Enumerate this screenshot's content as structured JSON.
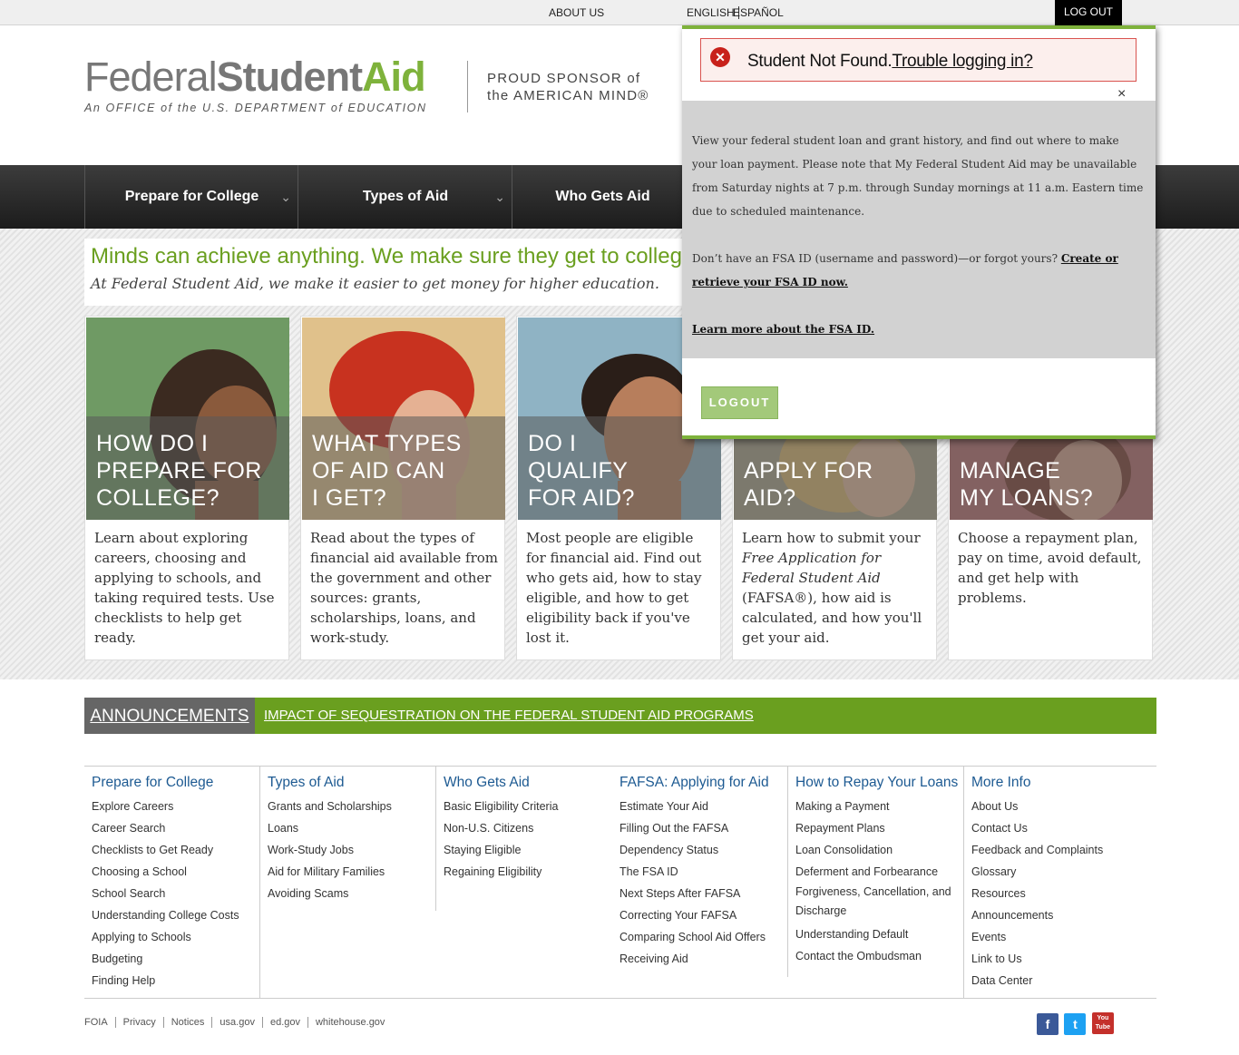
{
  "topbar": {
    "about": "ABOUT US",
    "lang_en": "ENGLISH",
    "lang_es": "ESPAÑOL",
    "logout": "LOG OUT"
  },
  "logo": {
    "federal": "Federal",
    "student": "Student",
    "aid": "Aid",
    "subtitle": "An OFFICE of the U.S. DEPARTMENT of EDUCATION",
    "sponsor_line1": "PROUD SPONSOR of",
    "sponsor_line2": "the AMERICAN MIND®"
  },
  "nav": {
    "items": [
      {
        "label": "Prepare for College",
        "has_dropdown": true
      },
      {
        "label": "Types of Aid",
        "has_dropdown": true
      },
      {
        "label": "Who Gets Aid",
        "has_dropdown": false
      }
    ]
  },
  "tagline": {
    "headline": "Minds can achieve anything. We make sure they get to college.",
    "sub": "At Federal Student Aid, we make it easier to get money for higher education."
  },
  "cards": [
    {
      "caption_l1": "HOW DO I",
      "caption_l2": "PREPARE FOR",
      "caption_l3": "COLLEGE?",
      "desc": "Learn about exploring careers, choosing and applying to schools, and taking required tests.  Use checklists to help get ready.",
      "color": "#6f9a64"
    },
    {
      "caption_l1": "WHAT TYPES",
      "caption_l2": "OF AID CAN",
      "caption_l3": "I GET?",
      "desc": "Read about the types of financial aid available from the government and other sources: grants, scholarships, loans, and work-study.",
      "color": "#d9b783"
    },
    {
      "caption_l1": "DO I",
      "caption_l2": "QUALIFY",
      "caption_l3": "FOR AID?",
      "desc": "Most people are eligible for financial aid. Find out who gets aid, how to stay eligible, and how to get eligibility back if you've lost it.",
      "color": "#8fb3c4"
    },
    {
      "caption_l1": "",
      "caption_l2": "APPLY FOR",
      "caption_l3": "AID?",
      "desc_html": true,
      "desc_a": "Learn how to submit your ",
      "desc_b": "Free Application for Federal Student Aid",
      "desc_c": " (FAFSA®), how aid is calculated, and how you'll get your aid.",
      "color": "#a7a186"
    },
    {
      "caption_l1": "",
      "caption_l2": "MANAGE",
      "caption_l3": "MY LOANS?",
      "desc": "Choose a repayment plan, pay on time, avoid default, and get help with problems.",
      "color": "#b76b6b"
    }
  ],
  "announcements": {
    "label": "ANNOUNCEMENTS",
    "link": "IMPACT OF SEQUESTRATION ON THE FEDERAL STUDENT AID PROGRAMS"
  },
  "footer": {
    "columns": [
      {
        "title": "Prepare for College",
        "items": [
          "Explore Careers",
          "Career Search",
          "Checklists to Get Ready",
          "Choosing a School",
          "School Search",
          "Understanding College Costs",
          "Applying to Schools",
          "Budgeting",
          "Finding Help"
        ]
      },
      {
        "title": "Types of Aid",
        "items": [
          "Grants and Scholarships",
          "Loans",
          "Work-Study Jobs",
          "Aid for Military Families",
          "Avoiding Scams"
        ]
      },
      {
        "title": "Who Gets Aid",
        "items": [
          "Basic Eligibility Criteria",
          "Non-U.S. Citizens",
          "Staying Eligible",
          "Regaining Eligibility"
        ]
      },
      {
        "title": "FAFSA: Applying for Aid",
        "items": [
          "Estimate Your Aid",
          "Filling Out the FAFSA",
          "Dependency Status",
          "The FSA ID",
          "Next Steps After FAFSA",
          "Correcting Your FAFSA",
          "Comparing School Aid Offers",
          "Receiving Aid"
        ]
      },
      {
        "title": "How to Repay Your Loans",
        "items": [
          "Making a Payment",
          "Repayment Plans",
          "Loan Consolidation",
          "Deferment and Forbearance",
          "Forgiveness, Cancellation, and Discharge",
          "Understanding Default",
          "Contact the Ombudsman"
        ]
      },
      {
        "title": "More Info",
        "items": [
          "About Us",
          "Contact Us",
          "Feedback and Complaints",
          "Glossary",
          "Resources",
          "Announcements",
          "Events",
          "Link to Us",
          "Data Center"
        ]
      }
    ],
    "legal": [
      "FOIA",
      "Privacy",
      "Notices",
      "usa.gov",
      "ed.gov",
      "whitehouse.gov"
    ],
    "social": [
      {
        "icon": "facebook-icon",
        "glyph": "f",
        "color": "#3b5998"
      },
      {
        "icon": "twitter-icon",
        "glyph": "t",
        "color": "#1da1f2"
      },
      {
        "icon": "youtube-icon",
        "glyph": "You Tube",
        "color": "#c4302b"
      }
    ]
  },
  "login_panel": {
    "error_text": "Student Not Found.",
    "error_link": "Trouble logging in?",
    "close": "×",
    "para1": "View your federal student loan and grant history, and find out where to make your loan payment. Please note that My Federal Student Aid may be unavailable from Saturday nights at 7 p.m. through Sunday mornings at 11 a.m. Eastern time due to scheduled maintenance.",
    "para2_text": "Don’t have an FSA ID (username and password)—or forgot yours? ",
    "para2_link": "Create or retrieve your FSA ID now.",
    "para3_link": "Learn more about the FSA ID.",
    "logout_button": "LOGOUT"
  }
}
